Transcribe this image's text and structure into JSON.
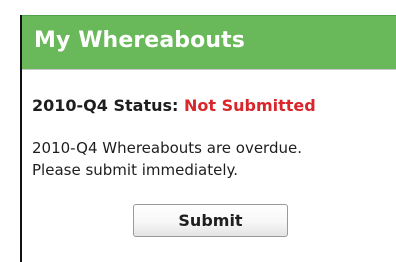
{
  "widget": {
    "title": "My Whereabouts",
    "status_label": "2010-Q4 Status:",
    "status_value": "Not Submitted",
    "message_lines": [
      "2010-Q4 Whereabouts are overdue.",
      "Please submit immediately."
    ],
    "submit_label": "Submit"
  },
  "colors": {
    "header_background": "#69b859",
    "header_text": "#ffffff",
    "status_value": "#d8262a",
    "body_text": "#1e1e1e"
  }
}
